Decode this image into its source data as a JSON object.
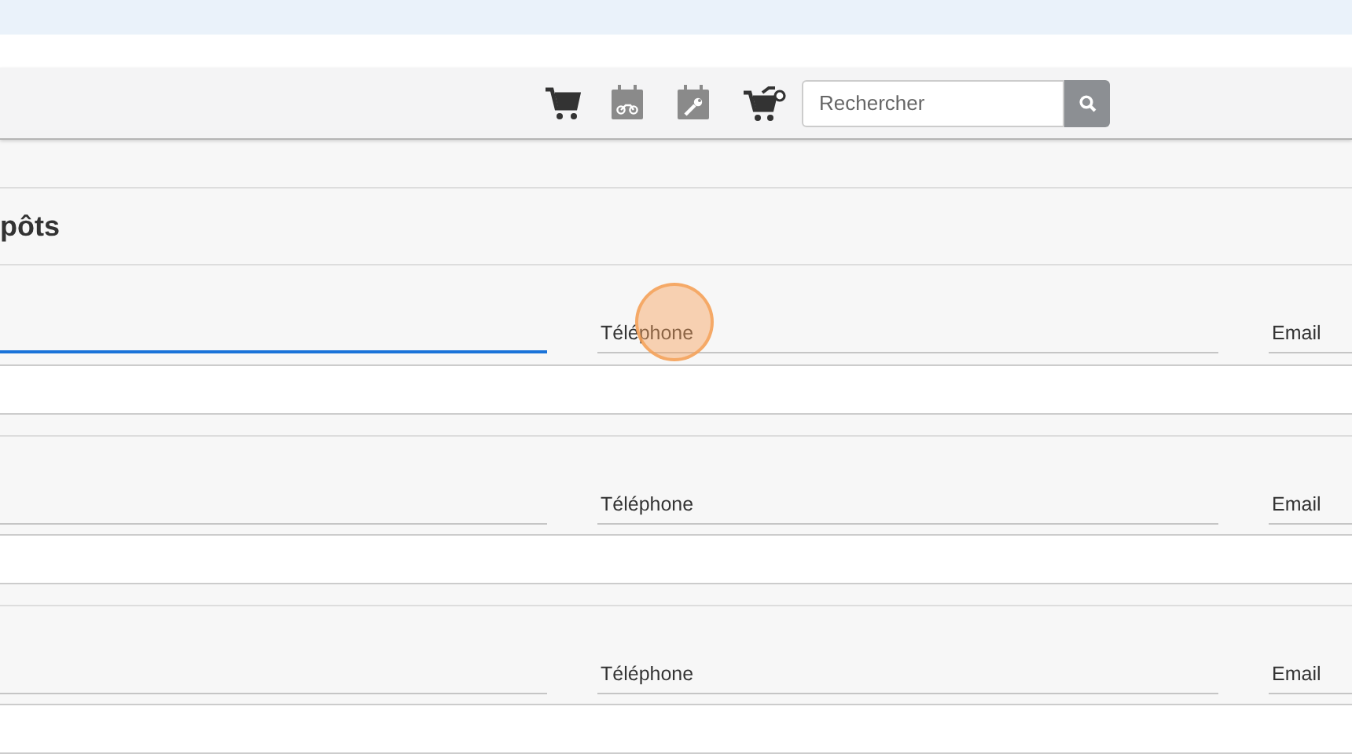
{
  "toolbar": {
    "icons": [
      {
        "kind": "cart"
      },
      {
        "kind": "calendar-moto"
      },
      {
        "kind": "calendar-wrench"
      },
      {
        "kind": "cart-moto"
      }
    ],
    "search": {
      "placeholder": "Rechercher"
    }
  },
  "heading": "pôts",
  "groups": [
    {
      "fields": [
        {
          "focused": true,
          "clicked": false
        },
        {
          "label": "Téléphone",
          "focused": false,
          "clicked": true
        },
        {
          "label": "Email",
          "focused": false,
          "clicked": false
        }
      ]
    },
    {
      "fields": [
        {
          "focused": false,
          "clicked": false
        },
        {
          "label": "Téléphone",
          "focused": false,
          "clicked": false
        },
        {
          "label": "Email",
          "focused": false,
          "clicked": false
        }
      ]
    },
    {
      "fields": [
        {
          "focused": false,
          "clicked": false
        },
        {
          "label": "Téléphone",
          "focused": false,
          "clicked": false
        },
        {
          "label": "Email",
          "focused": false,
          "clicked": false
        }
      ]
    }
  ]
}
